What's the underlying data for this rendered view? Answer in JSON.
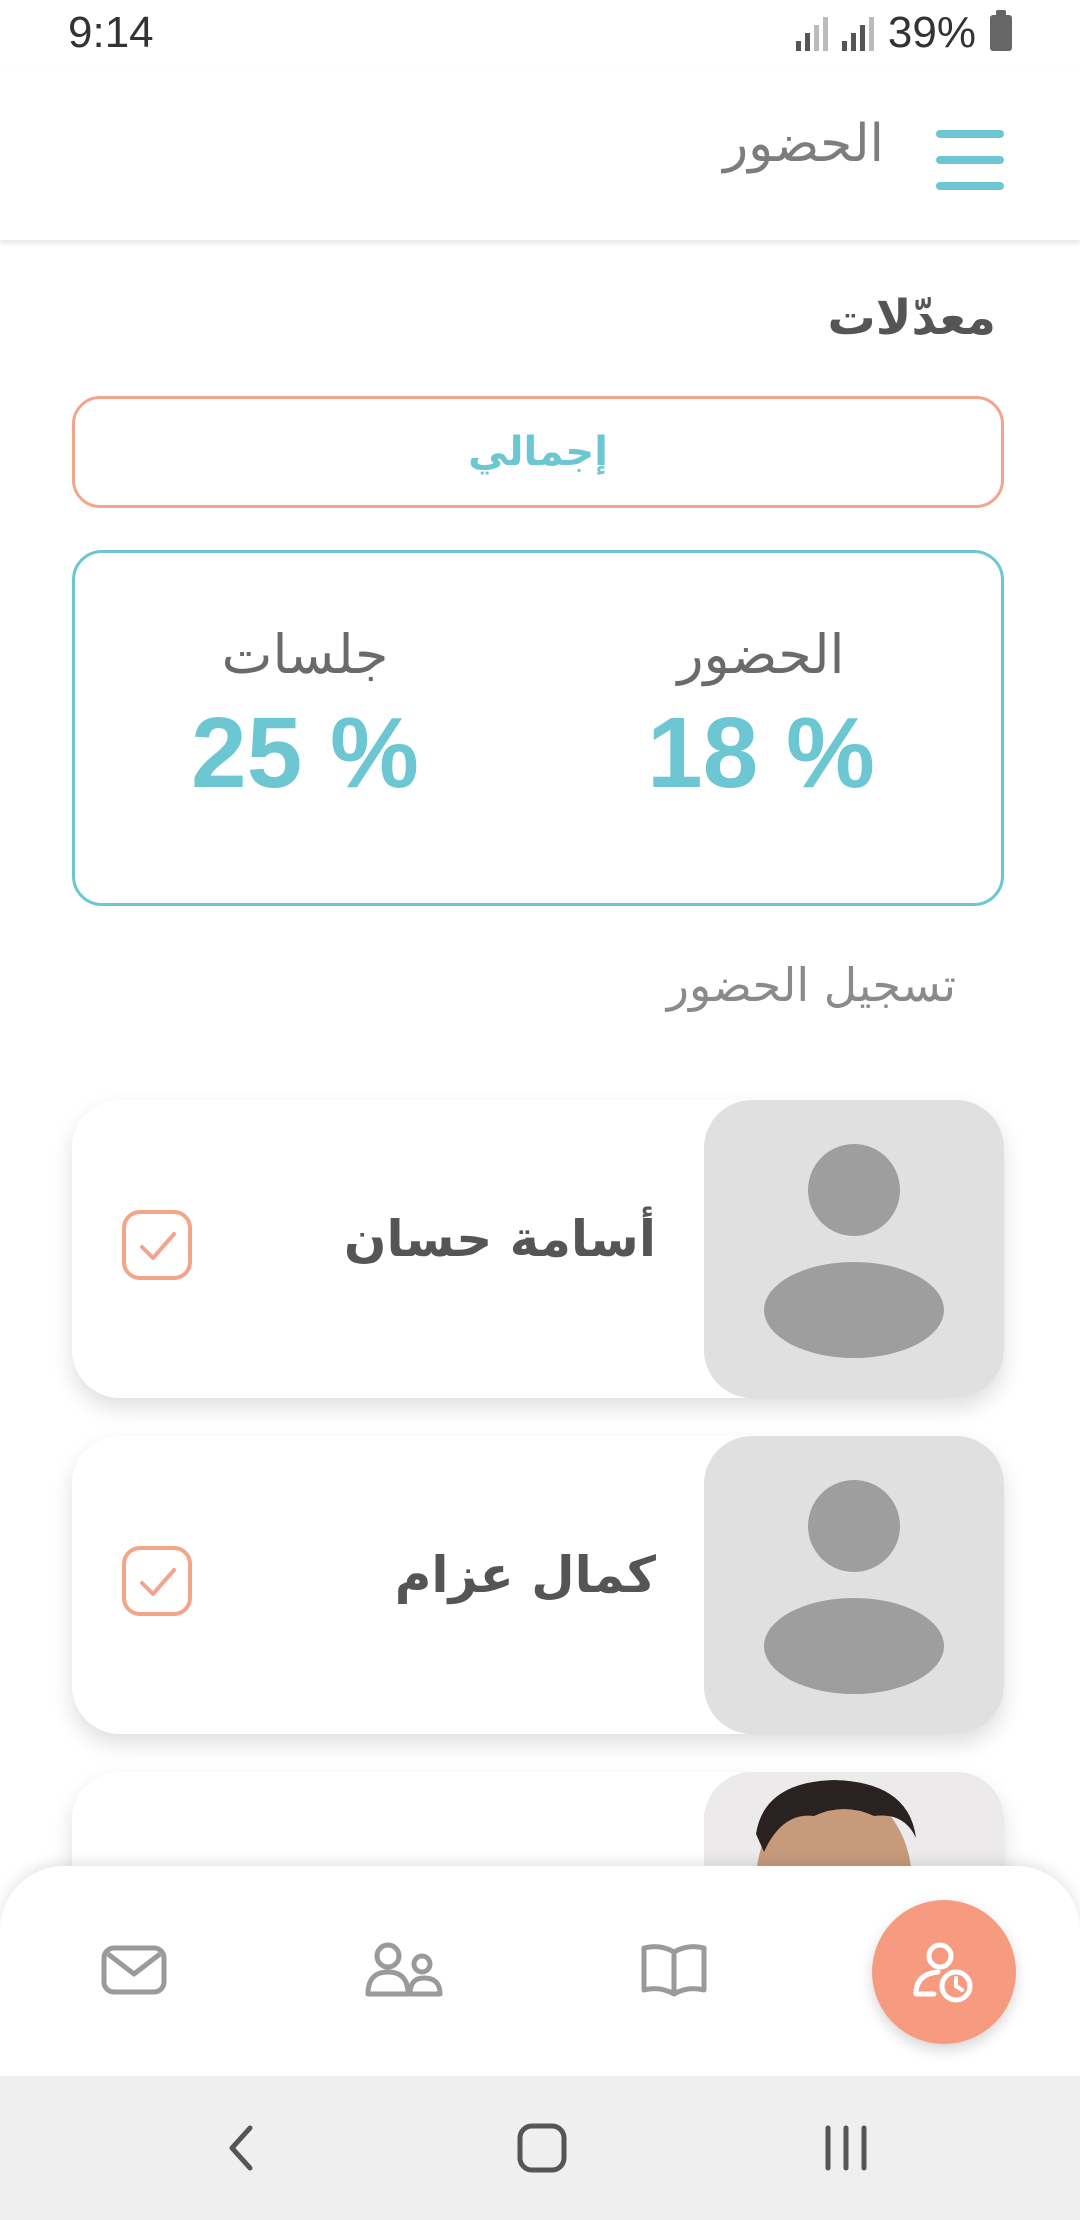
{
  "status_bar": {
    "time": "9:14",
    "battery": "39%"
  },
  "app_bar": {
    "title": "الحضور",
    "menu_icon": "hamburger-menu-icon"
  },
  "rates": {
    "title": "معدّلات",
    "total_button": "إجمالي",
    "attendance": {
      "label": "الحضور",
      "value": "18 %"
    },
    "sessions": {
      "label": "جلسات",
      "value": "25 %"
    }
  },
  "register": {
    "title": "تسجيل الحضور",
    "students": [
      {
        "name": "أسامة حسان",
        "checked": true,
        "avatar": "placeholder-avatar"
      },
      {
        "name": "كمال عزام",
        "checked": true,
        "avatar": "placeholder-avatar"
      },
      {
        "name": "",
        "checked": false,
        "avatar": "student-photo"
      }
    ]
  },
  "bottom_nav": {
    "items": [
      {
        "icon": "mail-icon"
      },
      {
        "icon": "group-icon"
      },
      {
        "icon": "book-icon"
      },
      {
        "icon": "attendance-clock-icon",
        "active": true
      }
    ]
  },
  "colors": {
    "accent": "#6cc7d3",
    "secondary": "#f5a48c",
    "fab": "#f79b80"
  }
}
